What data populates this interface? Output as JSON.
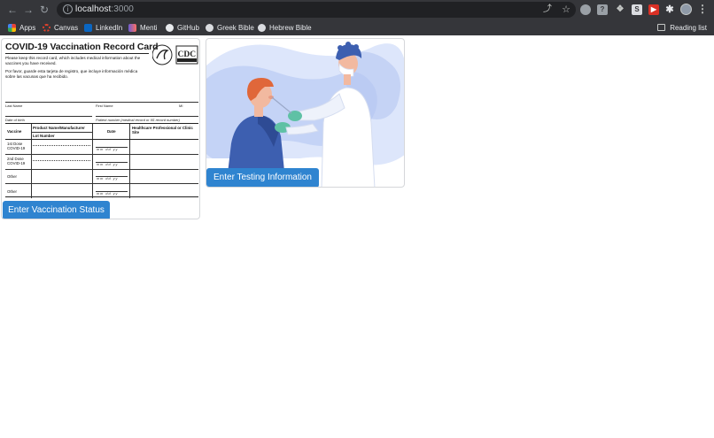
{
  "browser": {
    "url_host": "localhost",
    "url_port": ":3000",
    "bookmarks": [
      {
        "label": "Apps",
        "icon": "apps-grid-icon",
        "color": "#f4b400"
      },
      {
        "label": "Canvas",
        "icon": "canvas-icon",
        "color": "#e2412b"
      },
      {
        "label": "LinkedIn",
        "icon": "linkedin-icon",
        "color": "#0a66c2"
      },
      {
        "label": "Menti",
        "icon": "menti-icon",
        "color": "#6c5dd3"
      },
      {
        "label": "GitHub",
        "icon": "github-icon",
        "color": "#e8eaed"
      },
      {
        "label": "Greek Bible",
        "icon": "globe-icon",
        "color": "#e8eaed"
      },
      {
        "label": "Hebrew Bible",
        "icon": "globe-icon",
        "color": "#e8eaed"
      }
    ],
    "reading_list": "Reading list"
  },
  "vaccination_card": {
    "title": "COVID-19 Vaccination Record Card",
    "english_note": "Please keep this record card, which includes medical information about the vaccines you have received.",
    "spanish_note": "Por favor, guarde esta tarjeta de registro, que incluye información médica sobre las vacunas que ha recibido.",
    "logo_text": "CDC",
    "last_name": "Last Name",
    "first_name": "First Name",
    "mi": "MI",
    "dob": "Date of birth",
    "patient_number": "Patient number (medical record or IIS record number)",
    "col_vaccine": "Vaccine",
    "col_product": "Product Name/Manufacturer",
    "col_lot": "Lot Number",
    "col_date": "Date",
    "col_site": "Healthcare Professional or Clinic Site",
    "rows": [
      "1st Dose COVID-19",
      "2nd Dose COVID-19",
      "Other",
      "Other"
    ],
    "date_placeholder": "mm  dd  yy"
  },
  "actions": {
    "vaccination_button": "Enter Vaccination Status",
    "testing_button": "Enter Testing Information"
  },
  "colors": {
    "primary_button": "#2f84d0",
    "illustration_blue": "#3d5fb0"
  }
}
